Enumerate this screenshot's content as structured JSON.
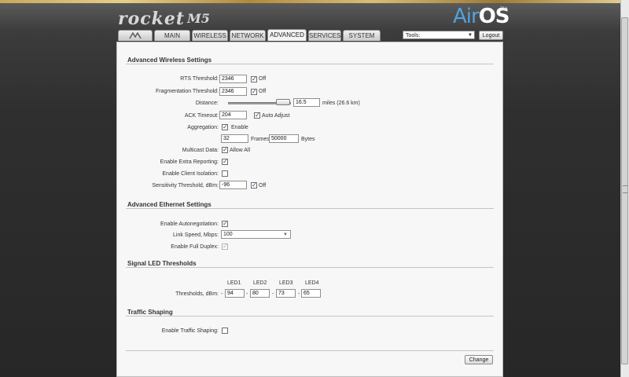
{
  "header": {
    "brand": "rocket",
    "model": "M5",
    "product_air": "Air",
    "product_os": "OS",
    "tm": "TM",
    "tools_label": "Tools:",
    "logout_label": "Logout"
  },
  "tabs": [
    {
      "label": "",
      "icon": "ubiquiti-logo-icon"
    },
    {
      "label": "MAIN"
    },
    {
      "label": "WIRELESS"
    },
    {
      "label": "NETWORK"
    },
    {
      "label": "ADVANCED",
      "active": true
    },
    {
      "label": "SERVICES"
    },
    {
      "label": "SYSTEM"
    }
  ],
  "wireless": {
    "title": "Advanced Wireless Settings",
    "rts_label": "RTS Threshold:",
    "rts_value": "2346",
    "rts_off_label": "Off",
    "frag_label": "Fragmentation Threshold:",
    "frag_value": "2346",
    "frag_off_label": "Off",
    "distance_label": "Distance:",
    "distance_value": "16.5",
    "distance_unit": "miles (26.6 km)",
    "ack_label": "ACK Timeout:",
    "ack_value": "204",
    "auto_adjust_label": "Auto Adjust",
    "aggregation_label": "Aggregation:",
    "aggregation_enable_label": "Enable",
    "frames_value": "32",
    "frames_label": "Frames",
    "bytes_value": "50000",
    "bytes_label": "Bytes",
    "multicast_label": "Multicast Data:",
    "allow_all_label": "Allow All",
    "extra_reporting_label": "Enable Extra Reporting:",
    "client_isolation_label": "Enable Client Isolation:",
    "sensitivity_label": "Sensitivity Threshold, dBm:",
    "sensitivity_value": "-96",
    "sensitivity_off_label": "Off"
  },
  "ethernet": {
    "title": "Advanced Ethernet Settings",
    "autoneg_label": "Enable Autonegotiation:",
    "link_speed_label": "Link Speed, Mbps:",
    "link_speed_value": "100",
    "full_duplex_label": "Enable Full Duplex:"
  },
  "led": {
    "title": "Signal LED Thresholds",
    "headers": [
      "LED1",
      "LED2",
      "LED3",
      "LED4"
    ],
    "thresholds_label": "Thresholds, dBm:",
    "dash": "-",
    "values": [
      "94",
      "80",
      "73",
      "65"
    ]
  },
  "traffic": {
    "title": "Traffic Shaping",
    "enable_label": "Enable Traffic Shaping:"
  },
  "footer": {
    "change_label": "Change"
  },
  "checkboxes": {
    "rts_off": true,
    "frag_off": true,
    "auto_adjust": true,
    "aggregation": true,
    "multicast": true,
    "extra_reporting": true,
    "client_isolation": false,
    "sensitivity_off": true,
    "autoneg": true,
    "full_duplex": true,
    "traffic_shaping": false
  },
  "slider": {
    "distance_fraction": 0.8
  },
  "colors": {
    "air_blue": "#4fa3df",
    "panel_bg": "#f7f7f7"
  }
}
